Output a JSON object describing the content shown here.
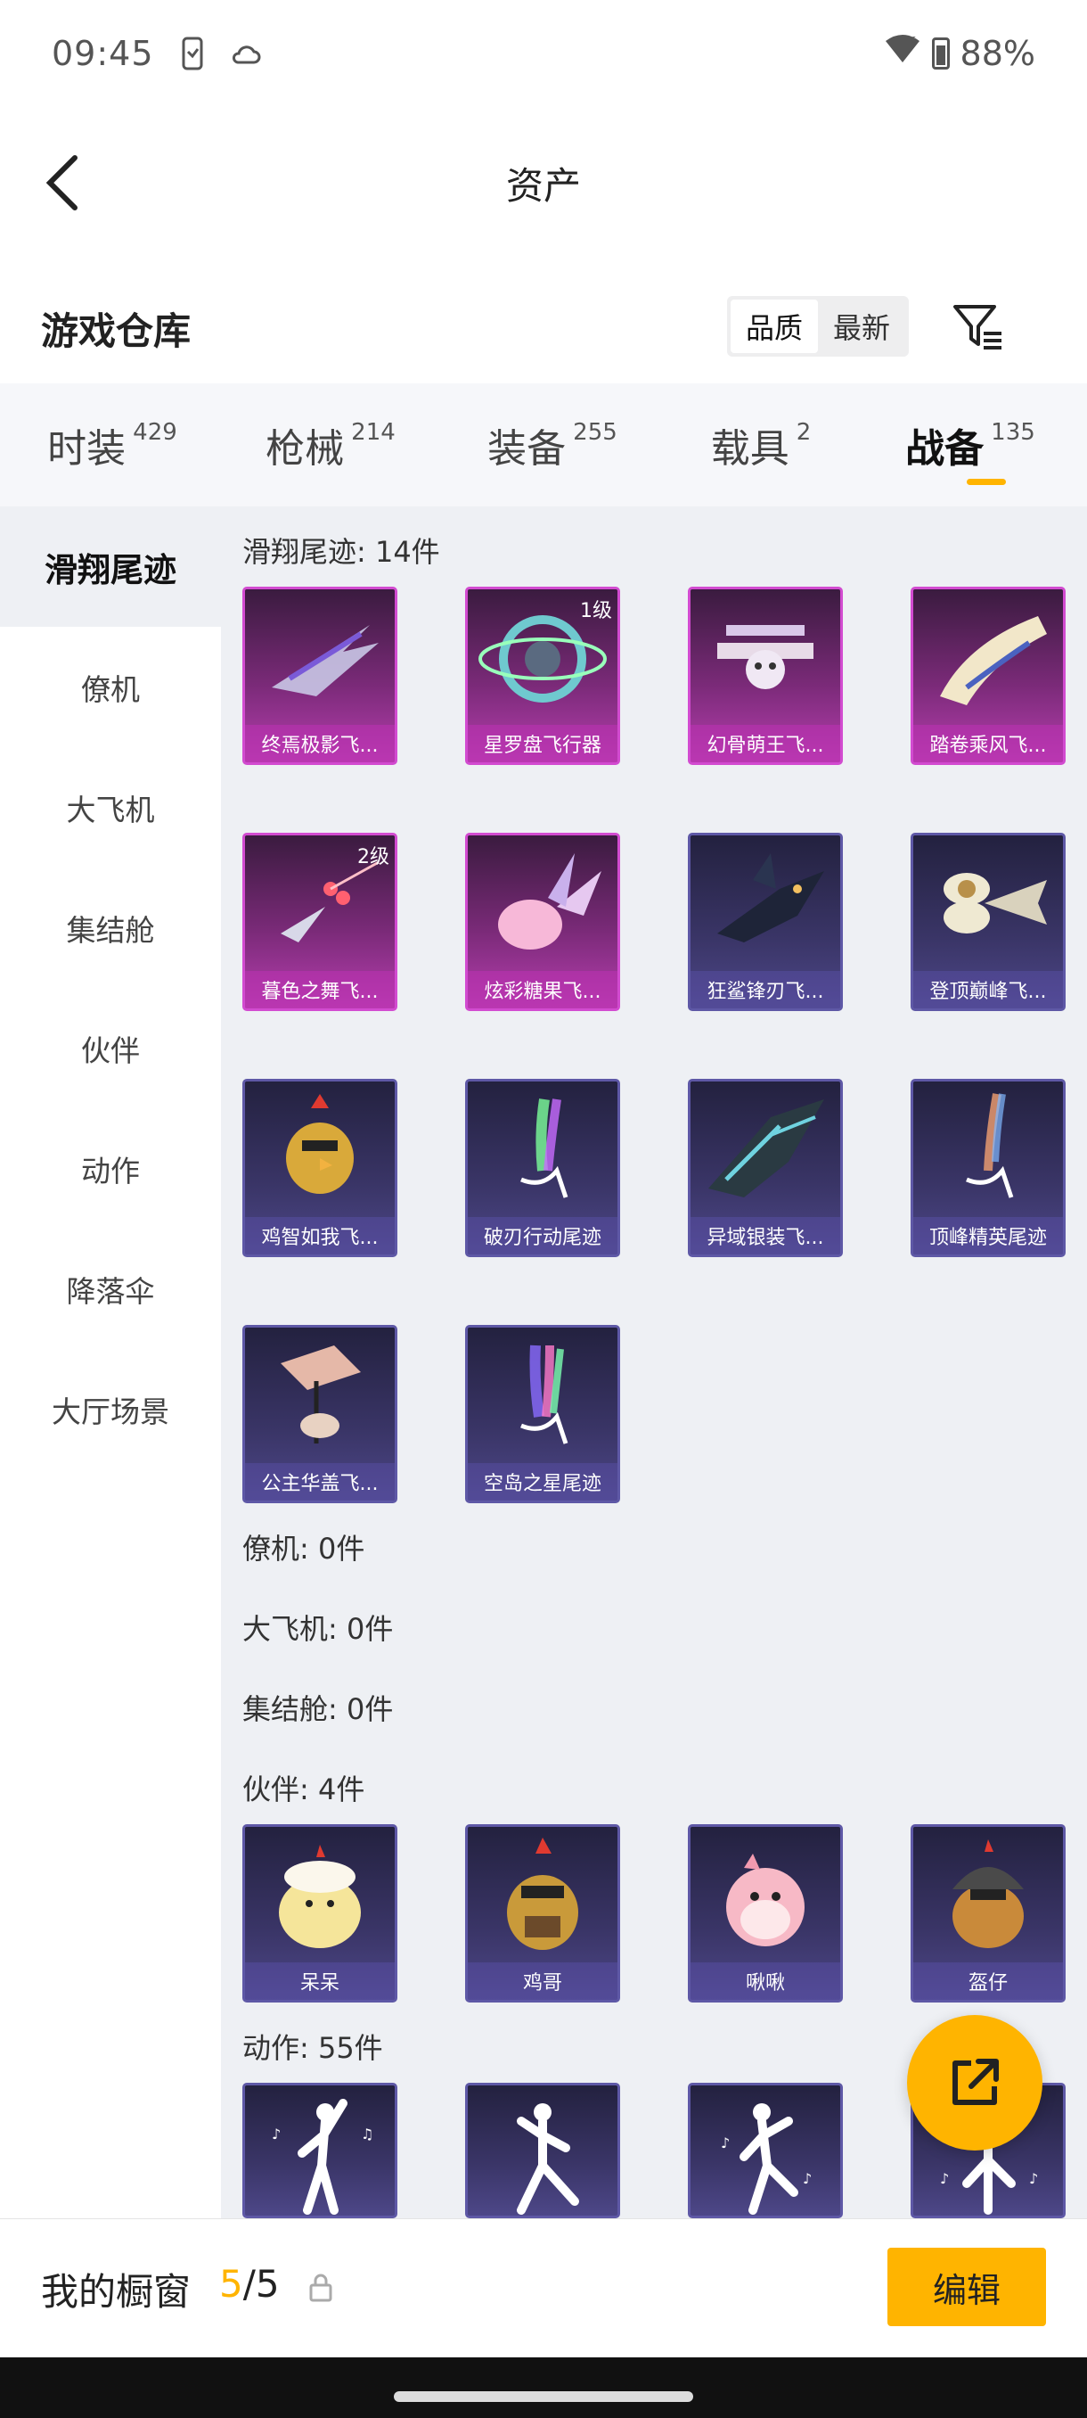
{
  "status": {
    "time": "09:45",
    "battery": "88%"
  },
  "header": {
    "title": "资产"
  },
  "warehouse": {
    "title": "游戏仓库",
    "sort_options": [
      "品质",
      "最新"
    ],
    "sort_selected": "品质"
  },
  "tabs": [
    {
      "label": "时装",
      "count": "429"
    },
    {
      "label": "枪械",
      "count": "214"
    },
    {
      "label": "装备",
      "count": "255"
    },
    {
      "label": "载具",
      "count": "2"
    },
    {
      "label": "战备",
      "count": "135",
      "active": true
    }
  ],
  "sidebar": [
    "滑翔尾迹",
    "僚机",
    "大飞机",
    "集结舱",
    "伙伴",
    "动作",
    "降落伞",
    "大厅场景"
  ],
  "sections": {
    "glide": {
      "title": "滑翔尾迹: 14件",
      "items": [
        {
          "name": "终焉极影飞...",
          "rarity": "purple"
        },
        {
          "name": "星罗盘飞行器",
          "rarity": "purple",
          "level": "1级"
        },
        {
          "name": "幻骨萌王飞...",
          "rarity": "purple"
        },
        {
          "name": "踏卷乘风飞...",
          "rarity": "purple"
        },
        {
          "name": "暮色之舞飞...",
          "rarity": "purple",
          "level": "2级"
        },
        {
          "name": "炫彩糖果飞...",
          "rarity": "purple"
        },
        {
          "name": "狂鲨锋刃飞...",
          "rarity": "blue"
        },
        {
          "name": "登顶巅峰飞...",
          "rarity": "blue"
        },
        {
          "name": "鸡智如我飞...",
          "rarity": "blue"
        },
        {
          "name": "破刃行动尾迹",
          "rarity": "blue"
        },
        {
          "name": "异域银装飞...",
          "rarity": "blue"
        },
        {
          "name": "顶峰精英尾迹",
          "rarity": "blue"
        },
        {
          "name": "公主华盖飞...",
          "rarity": "blue"
        },
        {
          "name": "空岛之星尾迹",
          "rarity": "blue"
        }
      ]
    },
    "wingman": {
      "title": "僚机: 0件"
    },
    "big_plane": {
      "title": "大飞机: 0件"
    },
    "capsule": {
      "title": "集结舱: 0件"
    },
    "companion": {
      "title": "伙伴: 4件",
      "items": [
        {
          "name": "呆呆",
          "rarity": "blue"
        },
        {
          "name": "鸡哥",
          "rarity": "blue"
        },
        {
          "name": "啾啾",
          "rarity": "blue"
        },
        {
          "name": "盔仔",
          "rarity": "blue"
        }
      ]
    },
    "emote": {
      "title": "动作: 55件"
    }
  },
  "showcase": {
    "label": "我的橱窗",
    "current": "5",
    "total": "/5",
    "edit_label": "编辑"
  },
  "colors": {
    "accent": "#ffb400",
    "content_bg": "#eef0f4"
  }
}
